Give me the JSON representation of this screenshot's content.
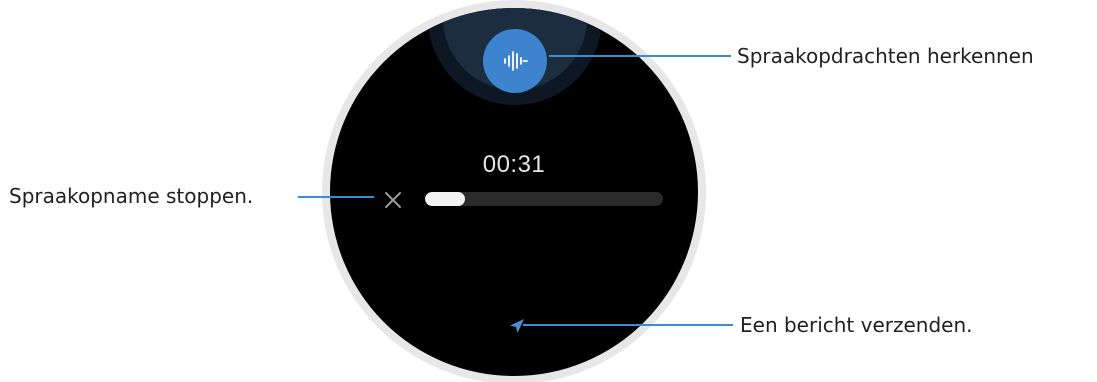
{
  "watch": {
    "timer": "00:31",
    "recording_progress": 0.17,
    "colors": {
      "screen": "#000000",
      "voice_button": "#3d83ce",
      "callout_line": "#3a8dd0"
    },
    "icons": {
      "voice": "voice-waveform-icon",
      "stop": "close-x-icon",
      "send": "send-arrow-icon"
    }
  },
  "callouts": {
    "voice_commands": "Spraakopdrachten herkennen",
    "stop_recording": "Spraakopname stoppen.",
    "send_message": "Een bericht verzenden."
  }
}
